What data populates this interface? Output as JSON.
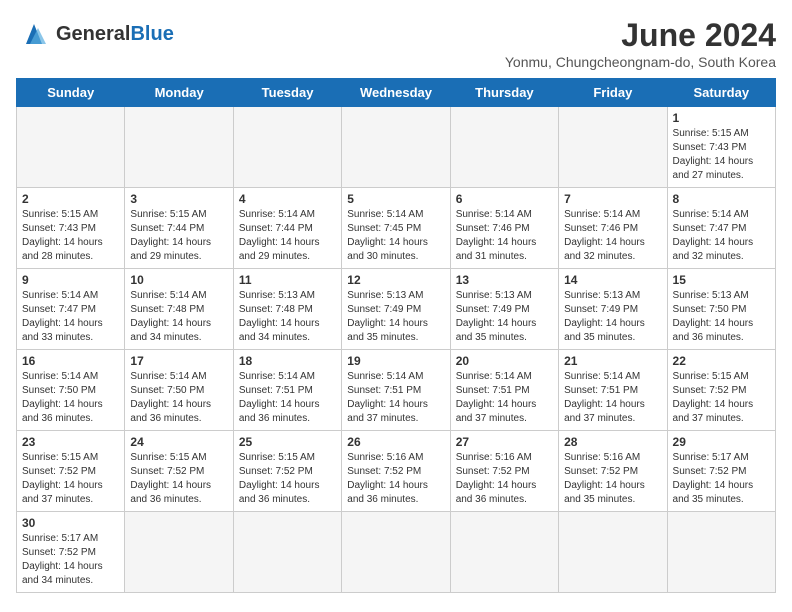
{
  "header": {
    "logo_general": "General",
    "logo_blue": "Blue",
    "month_title": "June 2024",
    "location": "Yonmu, Chungcheongnam-do, South Korea"
  },
  "weekdays": [
    "Sunday",
    "Monday",
    "Tuesday",
    "Wednesday",
    "Thursday",
    "Friday",
    "Saturday"
  ],
  "days": [
    {
      "date": null,
      "info": null
    },
    {
      "date": null,
      "info": null
    },
    {
      "date": null,
      "info": null
    },
    {
      "date": null,
      "info": null
    },
    {
      "date": null,
      "info": null
    },
    {
      "date": null,
      "info": null
    },
    {
      "date": "1",
      "info": "Sunrise: 5:15 AM\nSunset: 7:43 PM\nDaylight: 14 hours and 27 minutes."
    },
    {
      "date": "2",
      "info": "Sunrise: 5:15 AM\nSunset: 7:43 PM\nDaylight: 14 hours and 28 minutes."
    },
    {
      "date": "3",
      "info": "Sunrise: 5:15 AM\nSunset: 7:44 PM\nDaylight: 14 hours and 29 minutes."
    },
    {
      "date": "4",
      "info": "Sunrise: 5:14 AM\nSunset: 7:44 PM\nDaylight: 14 hours and 29 minutes."
    },
    {
      "date": "5",
      "info": "Sunrise: 5:14 AM\nSunset: 7:45 PM\nDaylight: 14 hours and 30 minutes."
    },
    {
      "date": "6",
      "info": "Sunrise: 5:14 AM\nSunset: 7:46 PM\nDaylight: 14 hours and 31 minutes."
    },
    {
      "date": "7",
      "info": "Sunrise: 5:14 AM\nSunset: 7:46 PM\nDaylight: 14 hours and 32 minutes."
    },
    {
      "date": "8",
      "info": "Sunrise: 5:14 AM\nSunset: 7:47 PM\nDaylight: 14 hours and 32 minutes."
    },
    {
      "date": "9",
      "info": "Sunrise: 5:14 AM\nSunset: 7:47 PM\nDaylight: 14 hours and 33 minutes."
    },
    {
      "date": "10",
      "info": "Sunrise: 5:14 AM\nSunset: 7:48 PM\nDaylight: 14 hours and 34 minutes."
    },
    {
      "date": "11",
      "info": "Sunrise: 5:13 AM\nSunset: 7:48 PM\nDaylight: 14 hours and 34 minutes."
    },
    {
      "date": "12",
      "info": "Sunrise: 5:13 AM\nSunset: 7:49 PM\nDaylight: 14 hours and 35 minutes."
    },
    {
      "date": "13",
      "info": "Sunrise: 5:13 AM\nSunset: 7:49 PM\nDaylight: 14 hours and 35 minutes."
    },
    {
      "date": "14",
      "info": "Sunrise: 5:13 AM\nSunset: 7:49 PM\nDaylight: 14 hours and 35 minutes."
    },
    {
      "date": "15",
      "info": "Sunrise: 5:13 AM\nSunset: 7:50 PM\nDaylight: 14 hours and 36 minutes."
    },
    {
      "date": "16",
      "info": "Sunrise: 5:14 AM\nSunset: 7:50 PM\nDaylight: 14 hours and 36 minutes."
    },
    {
      "date": "17",
      "info": "Sunrise: 5:14 AM\nSunset: 7:50 PM\nDaylight: 14 hours and 36 minutes."
    },
    {
      "date": "18",
      "info": "Sunrise: 5:14 AM\nSunset: 7:51 PM\nDaylight: 14 hours and 36 minutes."
    },
    {
      "date": "19",
      "info": "Sunrise: 5:14 AM\nSunset: 7:51 PM\nDaylight: 14 hours and 37 minutes."
    },
    {
      "date": "20",
      "info": "Sunrise: 5:14 AM\nSunset: 7:51 PM\nDaylight: 14 hours and 37 minutes."
    },
    {
      "date": "21",
      "info": "Sunrise: 5:14 AM\nSunset: 7:51 PM\nDaylight: 14 hours and 37 minutes."
    },
    {
      "date": "22",
      "info": "Sunrise: 5:15 AM\nSunset: 7:52 PM\nDaylight: 14 hours and 37 minutes."
    },
    {
      "date": "23",
      "info": "Sunrise: 5:15 AM\nSunset: 7:52 PM\nDaylight: 14 hours and 37 minutes."
    },
    {
      "date": "24",
      "info": "Sunrise: 5:15 AM\nSunset: 7:52 PM\nDaylight: 14 hours and 36 minutes."
    },
    {
      "date": "25",
      "info": "Sunrise: 5:15 AM\nSunset: 7:52 PM\nDaylight: 14 hours and 36 minutes."
    },
    {
      "date": "26",
      "info": "Sunrise: 5:16 AM\nSunset: 7:52 PM\nDaylight: 14 hours and 36 minutes."
    },
    {
      "date": "27",
      "info": "Sunrise: 5:16 AM\nSunset: 7:52 PM\nDaylight: 14 hours and 36 minutes."
    },
    {
      "date": "28",
      "info": "Sunrise: 5:16 AM\nSunset: 7:52 PM\nDaylight: 14 hours and 35 minutes."
    },
    {
      "date": "29",
      "info": "Sunrise: 5:17 AM\nSunset: 7:52 PM\nDaylight: 14 hours and 35 minutes."
    },
    {
      "date": "30",
      "info": "Sunrise: 5:17 AM\nSunset: 7:52 PM\nDaylight: 14 hours and 34 minutes."
    },
    {
      "date": null,
      "info": null
    },
    {
      "date": null,
      "info": null
    },
    {
      "date": null,
      "info": null
    },
    {
      "date": null,
      "info": null
    },
    {
      "date": null,
      "info": null
    },
    {
      "date": null,
      "info": null
    }
  ]
}
